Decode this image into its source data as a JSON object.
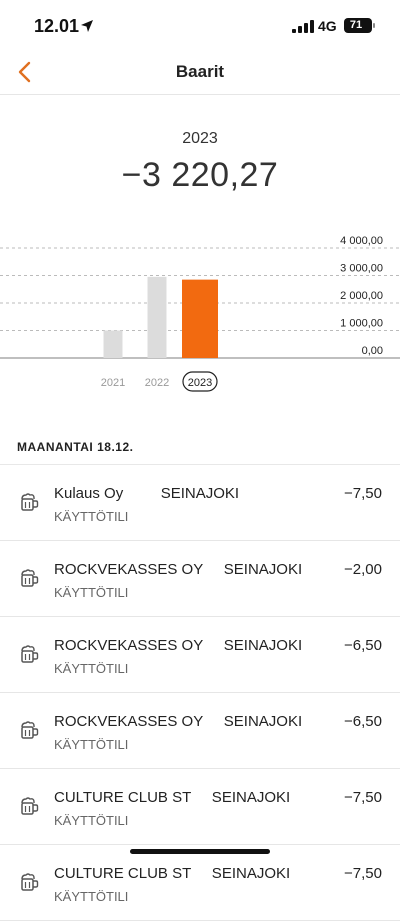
{
  "status": {
    "time": "12.01",
    "network": "4G",
    "battery": "71"
  },
  "nav": {
    "title": "Baarit"
  },
  "summary": {
    "year": "2023",
    "amount": "−3 220,27"
  },
  "chart_data": {
    "type": "bar",
    "categories": [
      "2021",
      "2022",
      "2023"
    ],
    "values": [
      1000,
      2950,
      2850
    ],
    "selected": "2023",
    "ylim": [
      0,
      4000
    ],
    "yticks": [
      "4 000,00",
      "3 000,00",
      "2 000,00",
      "1 000,00",
      "0,00"
    ],
    "colors": {
      "bar": "#dcdcdc",
      "selected": "#f26a10",
      "grid": "#bbbbbb"
    }
  },
  "section": {
    "title": "MAANANTAI 18.12."
  },
  "transactions": [
    {
      "merchant": "Kulaus Oy         SEINAJOKI",
      "account": "KÄYTTÖTILI",
      "amount": "−7,50"
    },
    {
      "merchant": "ROCKVEKASSES OY     SEINAJOKI",
      "account": "KÄYTTÖTILI",
      "amount": "−2,00"
    },
    {
      "merchant": "ROCKVEKASSES OY     SEINAJOKI",
      "account": "KÄYTTÖTILI",
      "amount": "−6,50"
    },
    {
      "merchant": "ROCKVEKASSES OY     SEINAJOKI",
      "account": "KÄYTTÖTILI",
      "amount": "−6,50"
    },
    {
      "merchant": "CULTURE CLUB ST     SEINAJOKI",
      "account": "KÄYTTÖTILI",
      "amount": "−7,50"
    },
    {
      "merchant": "CULTURE CLUB ST     SEINAJOKI",
      "account": "KÄYTTÖTILI",
      "amount": "−7,50"
    }
  ],
  "icons": {
    "back": "chevron-left-icon",
    "transaction": "beer-mug-icon",
    "location": "location-arrow-icon"
  },
  "colors": {
    "accent": "#f26a10"
  }
}
